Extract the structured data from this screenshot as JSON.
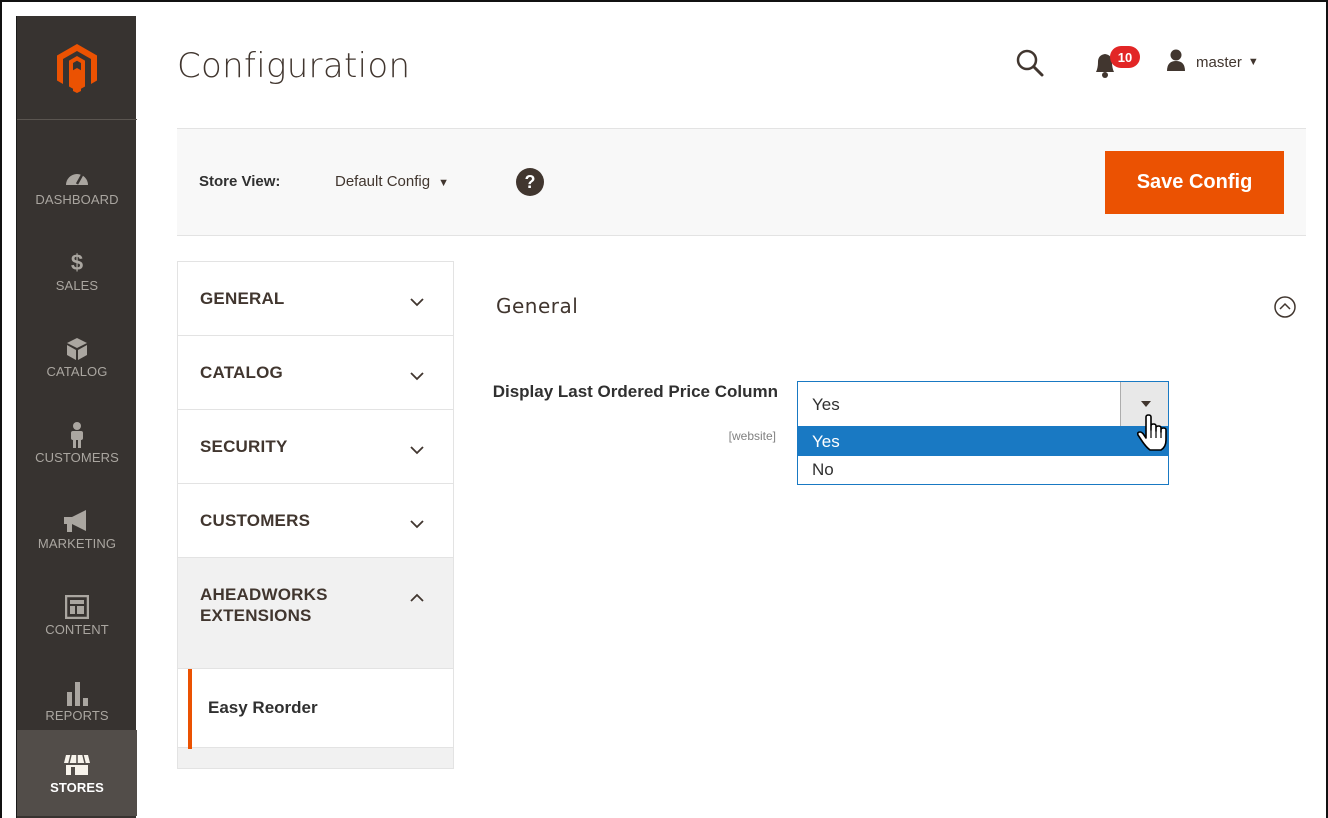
{
  "sidebar": {
    "logo": "magento-logo-icon",
    "items": [
      {
        "label": "DASHBOARD",
        "icon": "dashboard-gauge-icon",
        "active": false
      },
      {
        "label": "SALES",
        "icon": "dollar-icon",
        "active": false
      },
      {
        "label": "CATALOG",
        "icon": "box-icon",
        "active": false
      },
      {
        "label": "CUSTOMERS",
        "icon": "person-icon",
        "active": false
      },
      {
        "label": "MARKETING",
        "icon": "megaphone-icon",
        "active": false
      },
      {
        "label": "CONTENT",
        "icon": "layout-icon",
        "active": false
      },
      {
        "label": "REPORTS",
        "icon": "bar-chart-icon",
        "active": false
      },
      {
        "label": "STORES",
        "icon": "store-icon",
        "active": true
      }
    ]
  },
  "header": {
    "title": "Configuration",
    "notifications_count": "10",
    "user_name": "master"
  },
  "store_bar": {
    "label": "Store View:",
    "value": "Default Config",
    "help": "?",
    "save_label": "Save Config"
  },
  "tabs": [
    {
      "label": "GENERAL",
      "expanded": false
    },
    {
      "label": "CATALOG",
      "expanded": false
    },
    {
      "label": "SECURITY",
      "expanded": false
    },
    {
      "label": "CUSTOMERS",
      "expanded": false
    },
    {
      "label": "AHEADWORKS EXTENSIONS",
      "expanded": true
    }
  ],
  "subtab": {
    "label": "Easy Reorder"
  },
  "section": {
    "title": "General",
    "field_label": "Display Last Ordered Price Column",
    "field_scope": "[website]",
    "selected_value": "Yes",
    "options": [
      "Yes",
      "No"
    ]
  },
  "colors": {
    "sidebar_bg": "#373330",
    "accent": "#eb5202",
    "select_blue": "#1979c3",
    "badge_red": "#e22626"
  }
}
